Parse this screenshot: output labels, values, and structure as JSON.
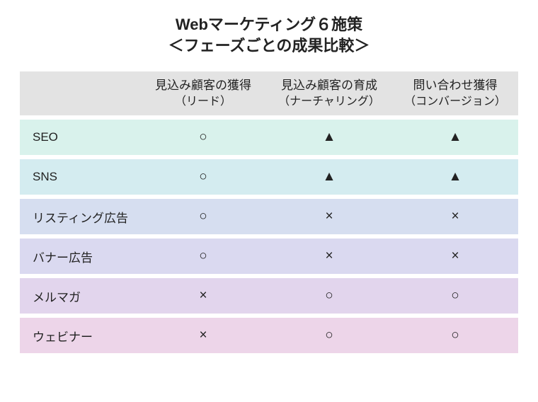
{
  "title_line1": "Webマーケティング６施策",
  "title_line2": "＜フェーズごとの成果比較＞",
  "columns": [
    {
      "label": "見込み顧客の獲得",
      "sub": "（リード）"
    },
    {
      "label": "見込み顧客の育成",
      "sub": "（ナーチャリング）"
    },
    {
      "label": "問い合わせ獲得",
      "sub": "（コンバージョン）"
    }
  ],
  "rows": [
    {
      "name": "SEO",
      "cells": [
        "○",
        "▲",
        "▲"
      ]
    },
    {
      "name": "SNS",
      "cells": [
        "○",
        "▲",
        "▲"
      ]
    },
    {
      "name": "リスティング広告",
      "cells": [
        "○",
        "×",
        "×"
      ]
    },
    {
      "name": "バナー広告",
      "cells": [
        "○",
        "×",
        "×"
      ]
    },
    {
      "name": "メルマガ",
      "cells": [
        "×",
        "○",
        "○"
      ]
    },
    {
      "name": "ウェビナー",
      "cells": [
        "×",
        "○",
        "○"
      ]
    }
  ]
}
